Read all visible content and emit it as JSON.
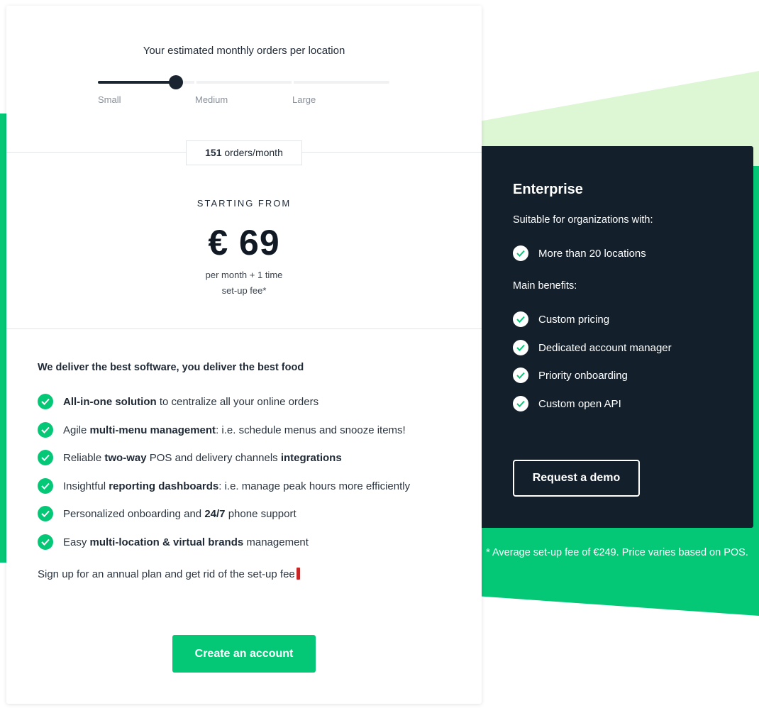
{
  "colors": {
    "brand_green": "#05c877",
    "light_green": "#ddf6d4",
    "dark_navy": "#13202c",
    "slider_dark": "#1b2531"
  },
  "slider": {
    "title": "Your estimated monthly orders per location",
    "labels": [
      "Small",
      "Medium",
      "Large"
    ],
    "value_fraction": 0.145
  },
  "orders": {
    "count": "151",
    "unit": "orders/month"
  },
  "pricing": {
    "starting_label": "STARTING FROM",
    "price": "€ 69",
    "note_line1": "per month + 1 time",
    "note_line2": "set-up fee*"
  },
  "features": {
    "title": "We deliver the best software, you deliver the best food",
    "items": [
      {
        "icon": "check-circle-icon",
        "parts": [
          {
            "text": "All-in-one solution",
            "bold": true
          },
          {
            "text": " to centralize all your online orders",
            "bold": false
          }
        ]
      },
      {
        "icon": "check-circle-icon",
        "parts": [
          {
            "text": "Agile ",
            "bold": false
          },
          {
            "text": "multi-menu management",
            "bold": true
          },
          {
            "text": ": i.e. schedule menus and snooze items!",
            "bold": false
          }
        ]
      },
      {
        "icon": "check-circle-icon",
        "parts": [
          {
            "text": "Reliable ",
            "bold": false
          },
          {
            "text": "two-way",
            "bold": true
          },
          {
            "text": " POS and delivery channels ",
            "bold": false
          },
          {
            "text": "integrations",
            "bold": true
          }
        ]
      },
      {
        "icon": "check-circle-icon",
        "parts": [
          {
            "text": "Insightful ",
            "bold": false
          },
          {
            "text": "reporting dashboards",
            "bold": true
          },
          {
            "text": ": i.e. manage peak hours more efficiently",
            "bold": false
          }
        ]
      },
      {
        "icon": "check-circle-icon",
        "parts": [
          {
            "text": "Personalized onboarding and ",
            "bold": false
          },
          {
            "text": "24/7",
            "bold": true
          },
          {
            "text": " phone support",
            "bold": false
          }
        ]
      },
      {
        "icon": "check-circle-icon",
        "parts": [
          {
            "text": "Easy ",
            "bold": false
          },
          {
            "text": "multi-location & virtual brands",
            "bold": true
          },
          {
            "text": " management",
            "bold": false
          }
        ]
      }
    ],
    "annual_note": "Sign up for an annual plan and get rid of the set-up fee"
  },
  "cta": {
    "label": "Create an account"
  },
  "enterprise": {
    "title": "Enterprise",
    "suitable_label": "Suitable for organizations with:",
    "suitable_items": [
      "More than 20 locations"
    ],
    "benefits_label": "Main benefits:",
    "benefits_items": [
      "Custom pricing",
      "Dedicated account manager",
      "Priority onboarding",
      "Custom open API"
    ],
    "demo_label": "Request a demo"
  },
  "footnote": "* Average set-up fee of €249. Price varies based on POS."
}
